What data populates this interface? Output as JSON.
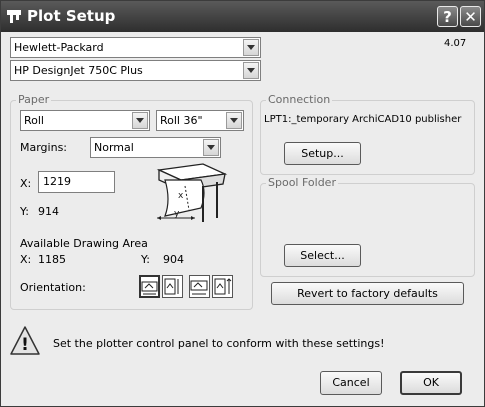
{
  "window": {
    "title": "Plot Setup",
    "help_label": "?",
    "close_label": "✕",
    "version": "4.07"
  },
  "plotter": {
    "manufacturer": "Hewlett-Packard",
    "model": "HP DesignJet 750C Plus"
  },
  "paper": {
    "group_label": "Paper",
    "type": "Roll",
    "size": "Roll 36\"",
    "margins_label": "Margins:",
    "margins_value": "Normal",
    "x_label": "X:",
    "x_value": "1219",
    "y_label": "Y:",
    "y_value": "914",
    "diagram_x": "x",
    "diagram_y": "y",
    "area_label": "Available Drawing Area",
    "area_x_label": "X:",
    "area_x_value": "1185",
    "area_y_label": "Y:",
    "area_y_value": "904",
    "orientation_label": "Orientation:"
  },
  "connection": {
    "group_label": "Connection",
    "port_text": "LPT1:_temporary ArchiCAD10 publisher",
    "setup_label": "Setup..."
  },
  "spool": {
    "group_label": "Spool Folder",
    "select_label": "Select..."
  },
  "revert_label": "Revert to factory defaults",
  "warning_text": "Set the plotter control panel to conform with these settings!",
  "warning_glyph": "!",
  "cancel_label": "Cancel",
  "ok_label": "OK"
}
